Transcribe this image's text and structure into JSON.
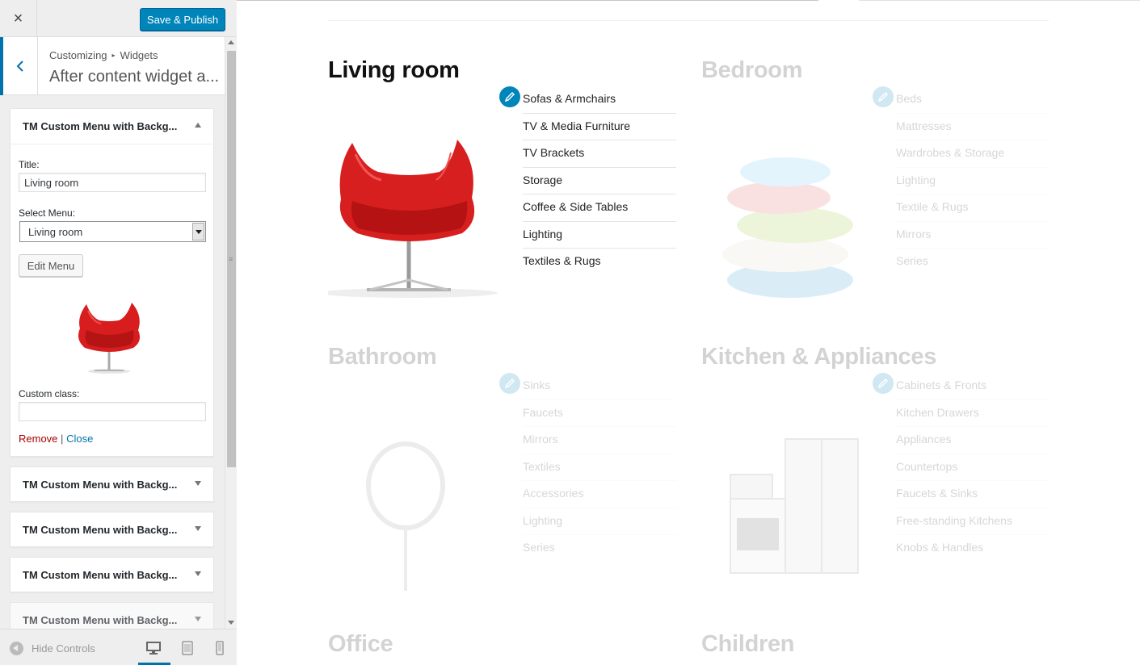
{
  "toolbar": {
    "close_icon": "×",
    "save_label": "Save & Publish"
  },
  "section": {
    "crumb_a": "Customizing",
    "crumb_sep": "▸",
    "crumb_b": "Widgets",
    "title": "After content widget a..."
  },
  "widget_open": {
    "title": "TM Custom Menu with Backg...",
    "title_label": "Title:",
    "title_value": "Living room",
    "menu_label": "Select Menu:",
    "menu_value": "Living room",
    "edit_menu": "Edit Menu",
    "custom_class_label": "Custom class:",
    "custom_class_value": "",
    "remove": "Remove",
    "pipe": "|",
    "close": "Close"
  },
  "widgets_collapsed": [
    {
      "title": "TM Custom Menu with Backg..."
    },
    {
      "title": "TM Custom Menu with Backg..."
    },
    {
      "title": "TM Custom Menu with Backg..."
    },
    {
      "title": "TM Custom Menu with Backg..."
    }
  ],
  "footer": {
    "hide_controls": "Hide Controls"
  },
  "preview": {
    "categories": [
      {
        "title": "Living room",
        "items": [
          "Sofas & Armchairs",
          "TV & Media Furniture",
          "TV Brackets",
          "Storage",
          "Coffee & Side Tables",
          "Lighting",
          "Textiles & Rugs"
        ]
      },
      {
        "title": "Bedroom",
        "items": [
          "Beds",
          "Mattresses",
          "Wardrobes & Storage",
          "Lighting",
          "Textile & Rugs",
          "Mirrors",
          "Series"
        ]
      },
      {
        "title": "Bathroom",
        "items": [
          "Sinks",
          "Faucets",
          "Mirrors",
          "Textiles",
          "Accessories",
          "Lighting",
          "Series"
        ]
      },
      {
        "title": "Kitchen & Appliances",
        "items": [
          "Cabinets & Fronts",
          "Kitchen Drawers",
          "Appliances",
          "Countertops",
          "Faucets & Sinks",
          "Free-standing Kitchens",
          "Knobs & Handles"
        ]
      },
      {
        "title": "Office",
        "items": []
      },
      {
        "title": "Children",
        "items": []
      }
    ]
  },
  "colors": {
    "accent": "#0085ba",
    "admin_blue": "#0073aa",
    "remove_red": "#a00"
  },
  "icons": [
    "close-icon",
    "chevron-left-icon",
    "chevron-up-icon",
    "chevron-down-icon",
    "pencil-icon",
    "desktop-icon",
    "tablet-icon",
    "mobile-icon",
    "collapse-icon"
  ]
}
